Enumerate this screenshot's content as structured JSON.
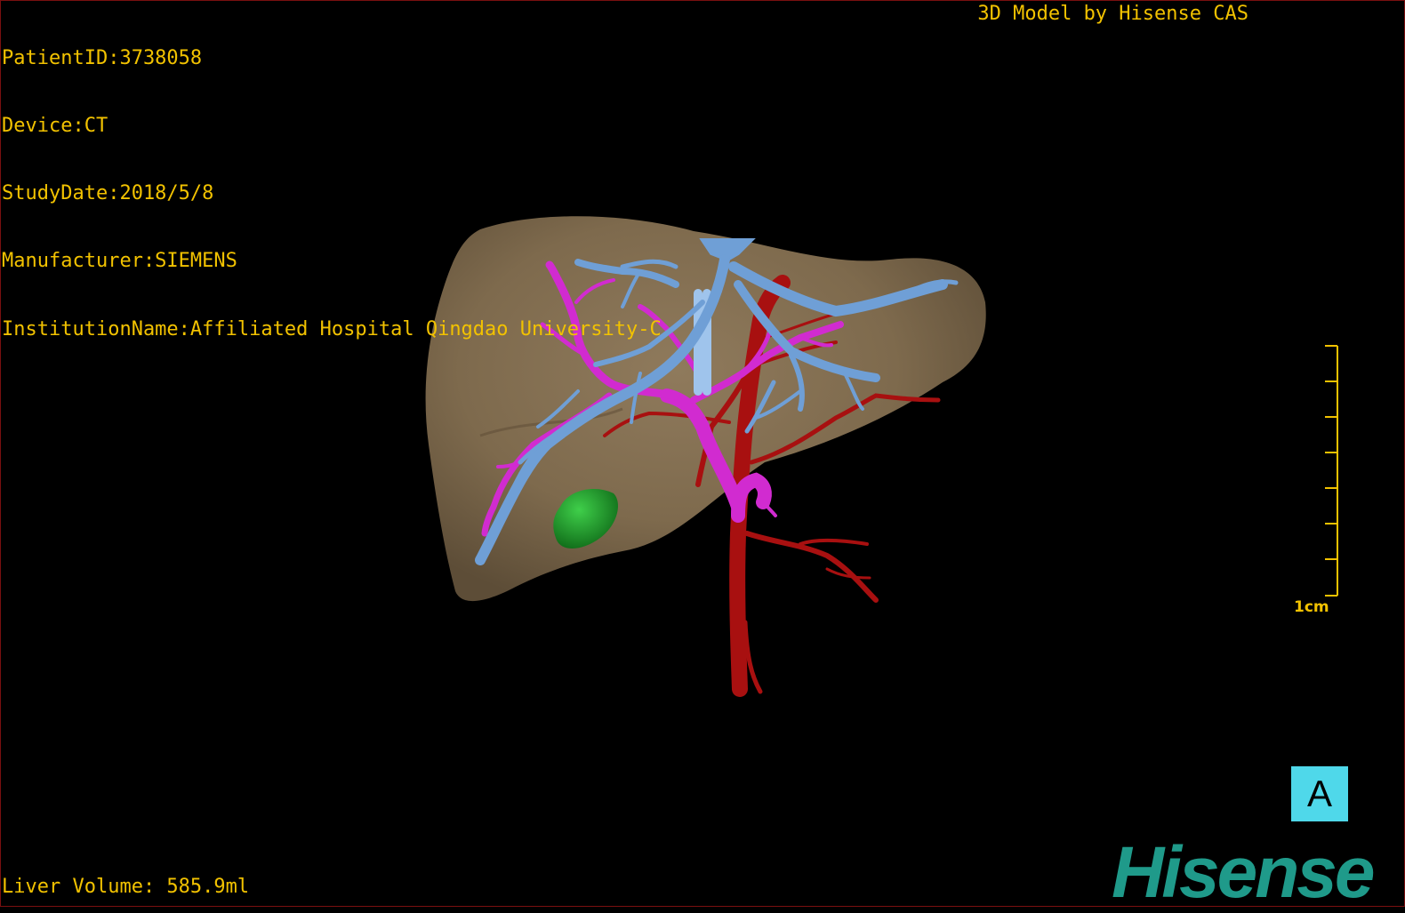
{
  "dicom_info": {
    "patient_id": "PatientID:3738058",
    "device": "Device:CT",
    "study_date": "StudyDate:2018/5/8",
    "manufacturer": "Manufacturer:SIEMENS",
    "institution": "InstitutionName:Affiliated Hospital Qingdao University-C"
  },
  "model_credit": "3D Model by Hisense CAS",
  "liver_volume": "Liver Volume: 585.9ml",
  "scale_bar": {
    "label": "1cm"
  },
  "orientation_marker": "A",
  "brand_logo": "Hisense",
  "colors": {
    "overlay_text": "#f2c200",
    "liver": "#8a7353",
    "hepatic_vein": "#6f9fd6",
    "portal_vein": "#d12bd0",
    "artery": "#a81010",
    "gallbladder": "#1f9a2a",
    "orientation_bg": "#4fd8ea",
    "brand": "#1f9a8a"
  },
  "structures": [
    "liver",
    "hepatic-vein",
    "portal-vein",
    "hepatic-artery",
    "gallbladder"
  ]
}
